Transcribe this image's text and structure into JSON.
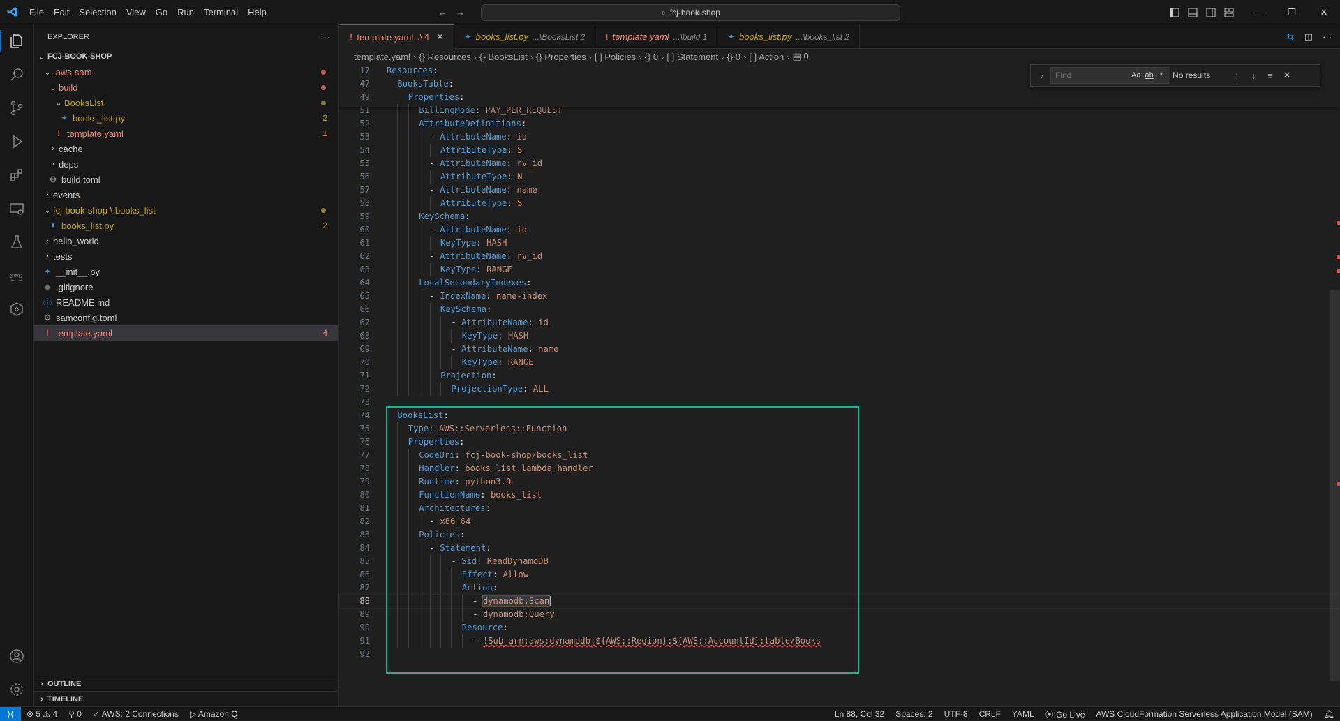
{
  "menu": [
    "File",
    "Edit",
    "Selection",
    "View",
    "Go",
    "Run",
    "Terminal",
    "Help"
  ],
  "command_center": "fcj-book-shop",
  "sidebar": {
    "title": "EXPLORER",
    "more": "···",
    "root": "FCJ-BOOK-SHOP",
    "tree": [
      {
        "label": ".aws-sam",
        "indent": 1,
        "type": "folder-open",
        "color": "red",
        "marker": "dot-red"
      },
      {
        "label": "build",
        "indent": 2,
        "type": "folder-open",
        "color": "red",
        "marker": "dot-red"
      },
      {
        "label": "BooksList",
        "indent": 3,
        "type": "folder-open",
        "color": "yellow",
        "marker": "dot-yellow"
      },
      {
        "label": "books_list.py",
        "indent": 4,
        "type": "py",
        "color": "yellow",
        "marker": "2"
      },
      {
        "label": "template.yaml",
        "indent": 3,
        "type": "yaml",
        "color": "red",
        "marker": "1"
      },
      {
        "label": "cache",
        "indent": 2,
        "type": "folder",
        "color": "white",
        "marker": ""
      },
      {
        "label": "deps",
        "indent": 2,
        "type": "folder",
        "color": "white",
        "marker": ""
      },
      {
        "label": "build.toml",
        "indent": 2,
        "type": "gear",
        "color": "white",
        "marker": ""
      },
      {
        "label": "events",
        "indent": 1,
        "type": "folder",
        "color": "white",
        "marker": ""
      },
      {
        "label": "fcj-book-shop \\ books_list",
        "indent": 1,
        "type": "folder-open",
        "color": "yellow",
        "marker": "dot-yellow"
      },
      {
        "label": "books_list.py",
        "indent": 2,
        "type": "py",
        "color": "yellow",
        "marker": "2"
      },
      {
        "label": "hello_world",
        "indent": 1,
        "type": "folder",
        "color": "white",
        "marker": ""
      },
      {
        "label": "tests",
        "indent": 1,
        "type": "folder",
        "color": "white",
        "marker": ""
      },
      {
        "label": "__init__.py",
        "indent": 1,
        "type": "py",
        "color": "white",
        "marker": ""
      },
      {
        "label": ".gitignore",
        "indent": 1,
        "type": "git",
        "color": "white",
        "marker": ""
      },
      {
        "label": "README.md",
        "indent": 1,
        "type": "info",
        "color": "white",
        "marker": ""
      },
      {
        "label": "samconfig.toml",
        "indent": 1,
        "type": "gear",
        "color": "white",
        "marker": ""
      },
      {
        "label": "template.yaml",
        "indent": 1,
        "type": "yaml",
        "color": "red",
        "marker": "4",
        "selected": true
      }
    ],
    "outline": "OUTLINE",
    "timeline": "TIMELINE"
  },
  "tabs": [
    {
      "label": "template.yaml",
      "desc": ".\\ 4",
      "icon": "!",
      "color": "red",
      "active": true,
      "close": "✕"
    },
    {
      "label": "books_list.py",
      "desc": "...\\BooksList 2",
      "icon": "py",
      "color": "yellow",
      "active": false
    },
    {
      "label": "template.yaml",
      "desc": "...\\build 1",
      "icon": "!",
      "color": "red",
      "active": false
    },
    {
      "label": "books_list.py",
      "desc": "...\\books_list 2",
      "icon": "py",
      "color": "yellow",
      "active": false
    }
  ],
  "breadcrumb": [
    "template.yaml",
    "{} Resources",
    "{} BooksList",
    "{} Properties",
    "[ ] Policies",
    "{} 0",
    "[ ] Statement",
    "{} 0",
    "[ ] Action",
    "▤ 0"
  ],
  "find": {
    "placeholder": "Find",
    "opt_case": "Aa",
    "opt_word": "ab",
    "opt_regex": ".*",
    "result": "No results"
  },
  "code_lines": [
    {
      "n": "17",
      "indent": 0,
      "parts": [
        [
          "k",
          "Resources"
        ],
        [
          "p",
          ":"
        ]
      ],
      "sticky": true
    },
    {
      "n": "47",
      "indent": 1,
      "parts": [
        [
          "k",
          "BooksTable"
        ],
        [
          "p",
          ":"
        ]
      ],
      "sticky": true
    },
    {
      "n": "49",
      "indent": 2,
      "parts": [
        [
          "k",
          "Properties"
        ],
        [
          "p",
          ":"
        ]
      ],
      "sticky": true
    },
    {
      "n": "51",
      "indent": 3,
      "parts": [
        [
          "k",
          "BillingMode"
        ],
        [
          "p",
          ": "
        ],
        [
          "s",
          "PAY_PER_REQUEST"
        ]
      ]
    },
    {
      "n": "52",
      "indent": 3,
      "parts": [
        [
          "k",
          "AttributeDefinitions"
        ],
        [
          "p",
          ":"
        ]
      ]
    },
    {
      "n": "53",
      "indent": 4,
      "parts": [
        [
          "p",
          "- "
        ],
        [
          "k",
          "AttributeName"
        ],
        [
          "p",
          ": "
        ],
        [
          "s",
          "id"
        ]
      ]
    },
    {
      "n": "54",
      "indent": 5,
      "parts": [
        [
          "k",
          "AttributeType"
        ],
        [
          "p",
          ": "
        ],
        [
          "s",
          "S"
        ]
      ]
    },
    {
      "n": "55",
      "indent": 4,
      "parts": [
        [
          "p",
          "- "
        ],
        [
          "k",
          "AttributeName"
        ],
        [
          "p",
          ": "
        ],
        [
          "s",
          "rv_id"
        ]
      ]
    },
    {
      "n": "56",
      "indent": 5,
      "parts": [
        [
          "k",
          "AttributeType"
        ],
        [
          "p",
          ": "
        ],
        [
          "s",
          "N"
        ]
      ]
    },
    {
      "n": "57",
      "indent": 4,
      "parts": [
        [
          "p",
          "- "
        ],
        [
          "k",
          "AttributeName"
        ],
        [
          "p",
          ": "
        ],
        [
          "s",
          "name"
        ]
      ]
    },
    {
      "n": "58",
      "indent": 5,
      "parts": [
        [
          "k",
          "AttributeType"
        ],
        [
          "p",
          ": "
        ],
        [
          "s",
          "S"
        ]
      ]
    },
    {
      "n": "59",
      "indent": 3,
      "parts": [
        [
          "k",
          "KeySchema"
        ],
        [
          "p",
          ":"
        ]
      ]
    },
    {
      "n": "60",
      "indent": 4,
      "parts": [
        [
          "p",
          "- "
        ],
        [
          "k",
          "AttributeName"
        ],
        [
          "p",
          ": "
        ],
        [
          "s",
          "id"
        ]
      ]
    },
    {
      "n": "61",
      "indent": 5,
      "parts": [
        [
          "k",
          "KeyType"
        ],
        [
          "p",
          ": "
        ],
        [
          "s",
          "HASH"
        ]
      ]
    },
    {
      "n": "62",
      "indent": 4,
      "parts": [
        [
          "p",
          "- "
        ],
        [
          "k",
          "AttributeName"
        ],
        [
          "p",
          ": "
        ],
        [
          "s",
          "rv_id"
        ]
      ]
    },
    {
      "n": "63",
      "indent": 5,
      "parts": [
        [
          "k",
          "KeyType"
        ],
        [
          "p",
          ": "
        ],
        [
          "s",
          "RANGE"
        ]
      ]
    },
    {
      "n": "64",
      "indent": 3,
      "parts": [
        [
          "k",
          "LocalSecondaryIndexes"
        ],
        [
          "p",
          ":"
        ]
      ]
    },
    {
      "n": "65",
      "indent": 4,
      "parts": [
        [
          "p",
          "- "
        ],
        [
          "k",
          "IndexName"
        ],
        [
          "p",
          ": "
        ],
        [
          "s",
          "name-index"
        ]
      ]
    },
    {
      "n": "66",
      "indent": 5,
      "parts": [
        [
          "k",
          "KeySchema"
        ],
        [
          "p",
          ":"
        ]
      ]
    },
    {
      "n": "67",
      "indent": 6,
      "parts": [
        [
          "p",
          "- "
        ],
        [
          "k",
          "AttributeName"
        ],
        [
          "p",
          ": "
        ],
        [
          "s",
          "id"
        ]
      ]
    },
    {
      "n": "68",
      "indent": 7,
      "parts": [
        [
          "k",
          "KeyType"
        ],
        [
          "p",
          ": "
        ],
        [
          "s",
          "HASH"
        ]
      ]
    },
    {
      "n": "69",
      "indent": 6,
      "parts": [
        [
          "p",
          "- "
        ],
        [
          "k",
          "AttributeName"
        ],
        [
          "p",
          ": "
        ],
        [
          "s",
          "name"
        ]
      ]
    },
    {
      "n": "70",
      "indent": 7,
      "parts": [
        [
          "k",
          "KeyType"
        ],
        [
          "p",
          ": "
        ],
        [
          "s",
          "RANGE"
        ]
      ]
    },
    {
      "n": "71",
      "indent": 5,
      "parts": [
        [
          "k",
          "Projection"
        ],
        [
          "p",
          ":"
        ]
      ]
    },
    {
      "n": "72",
      "indent": 6,
      "parts": [
        [
          "k",
          "ProjectionType"
        ],
        [
          "p",
          ": "
        ],
        [
          "s",
          "ALL"
        ]
      ]
    },
    {
      "n": "73",
      "indent": 0,
      "parts": []
    },
    {
      "n": "74",
      "indent": 1,
      "parts": [
        [
          "k",
          "BooksList"
        ],
        [
          "p",
          ":"
        ]
      ]
    },
    {
      "n": "75",
      "indent": 2,
      "parts": [
        [
          "k",
          "Type"
        ],
        [
          "p",
          ": "
        ],
        [
          "s",
          "AWS::Serverless::Function"
        ]
      ]
    },
    {
      "n": "76",
      "indent": 2,
      "parts": [
        [
          "k",
          "Properties"
        ],
        [
          "p",
          ":"
        ]
      ]
    },
    {
      "n": "77",
      "indent": 3,
      "parts": [
        [
          "k",
          "CodeUri"
        ],
        [
          "p",
          ": "
        ],
        [
          "s",
          "fcj-book-shop/books_list"
        ]
      ]
    },
    {
      "n": "78",
      "indent": 3,
      "parts": [
        [
          "k",
          "Handler"
        ],
        [
          "p",
          ": "
        ],
        [
          "s",
          "books_list.lambda_handler"
        ]
      ]
    },
    {
      "n": "79",
      "indent": 3,
      "parts": [
        [
          "k",
          "Runtime"
        ],
        [
          "p",
          ": "
        ],
        [
          "s",
          "python3.9"
        ]
      ]
    },
    {
      "n": "80",
      "indent": 3,
      "parts": [
        [
          "k",
          "FunctionName"
        ],
        [
          "p",
          ": "
        ],
        [
          "s",
          "books_list"
        ]
      ]
    },
    {
      "n": "81",
      "indent": 3,
      "parts": [
        [
          "k",
          "Architectures"
        ],
        [
          "p",
          ":"
        ]
      ]
    },
    {
      "n": "82",
      "indent": 4,
      "parts": [
        [
          "p",
          "- "
        ],
        [
          "s",
          "x86_64"
        ]
      ]
    },
    {
      "n": "83",
      "indent": 3,
      "parts": [
        [
          "k",
          "Policies"
        ],
        [
          "p",
          ":"
        ]
      ]
    },
    {
      "n": "84",
      "indent": 4,
      "parts": [
        [
          "p",
          "- "
        ],
        [
          "k",
          "Statement"
        ],
        [
          "p",
          ":"
        ]
      ]
    },
    {
      "n": "85",
      "indent": 6,
      "parts": [
        [
          "p",
          "- "
        ],
        [
          "k",
          "Sid"
        ],
        [
          "p",
          ": "
        ],
        [
          "s",
          "ReadDynamoDB"
        ]
      ]
    },
    {
      "n": "86",
      "indent": 7,
      "parts": [
        [
          "k",
          "Effect"
        ],
        [
          "p",
          ": "
        ],
        [
          "s",
          "Allow"
        ]
      ]
    },
    {
      "n": "87",
      "indent": 7,
      "parts": [
        [
          "k",
          "Action"
        ],
        [
          "p",
          ":"
        ]
      ]
    },
    {
      "n": "88",
      "indent": 8,
      "parts": [
        [
          "p",
          "- "
        ],
        [
          "hl",
          "dynamodb:Scan"
        ]
      ],
      "current": true
    },
    {
      "n": "89",
      "indent": 8,
      "parts": [
        [
          "p",
          "- "
        ],
        [
          "s",
          "dynamodb:Query"
        ]
      ]
    },
    {
      "n": "90",
      "indent": 7,
      "parts": [
        [
          "k",
          "Resource"
        ],
        [
          "p",
          ":"
        ]
      ]
    },
    {
      "n": "91",
      "indent": 8,
      "parts": [
        [
          "p",
          "- "
        ],
        [
          "sq",
          "!Sub arn:aws:dynamodb:${AWS::Region}:${AWS::AccountId}:table/Books"
        ]
      ]
    },
    {
      "n": "92",
      "indent": 0,
      "parts": []
    }
  ],
  "status": {
    "problems": "⊗ 5 ⚠ 4",
    "ports": "⚲ 0",
    "aws": "✓ AWS: 2 Connections",
    "amazonq": "▷ Amazon Q",
    "position": "Ln 88, Col 32",
    "spaces": "Spaces: 2",
    "encoding": "UTF-8",
    "eol": "CRLF",
    "language": "YAML",
    "golive": "⦿ Go Live",
    "schema": "AWS CloudFormation Serverless Application Model (SAM)"
  },
  "colors": {
    "accent": "#0078d4",
    "highlight_box": "#1ab394",
    "key": "#569cd6",
    "string": "#ce9178",
    "error": "#f14c4c"
  }
}
